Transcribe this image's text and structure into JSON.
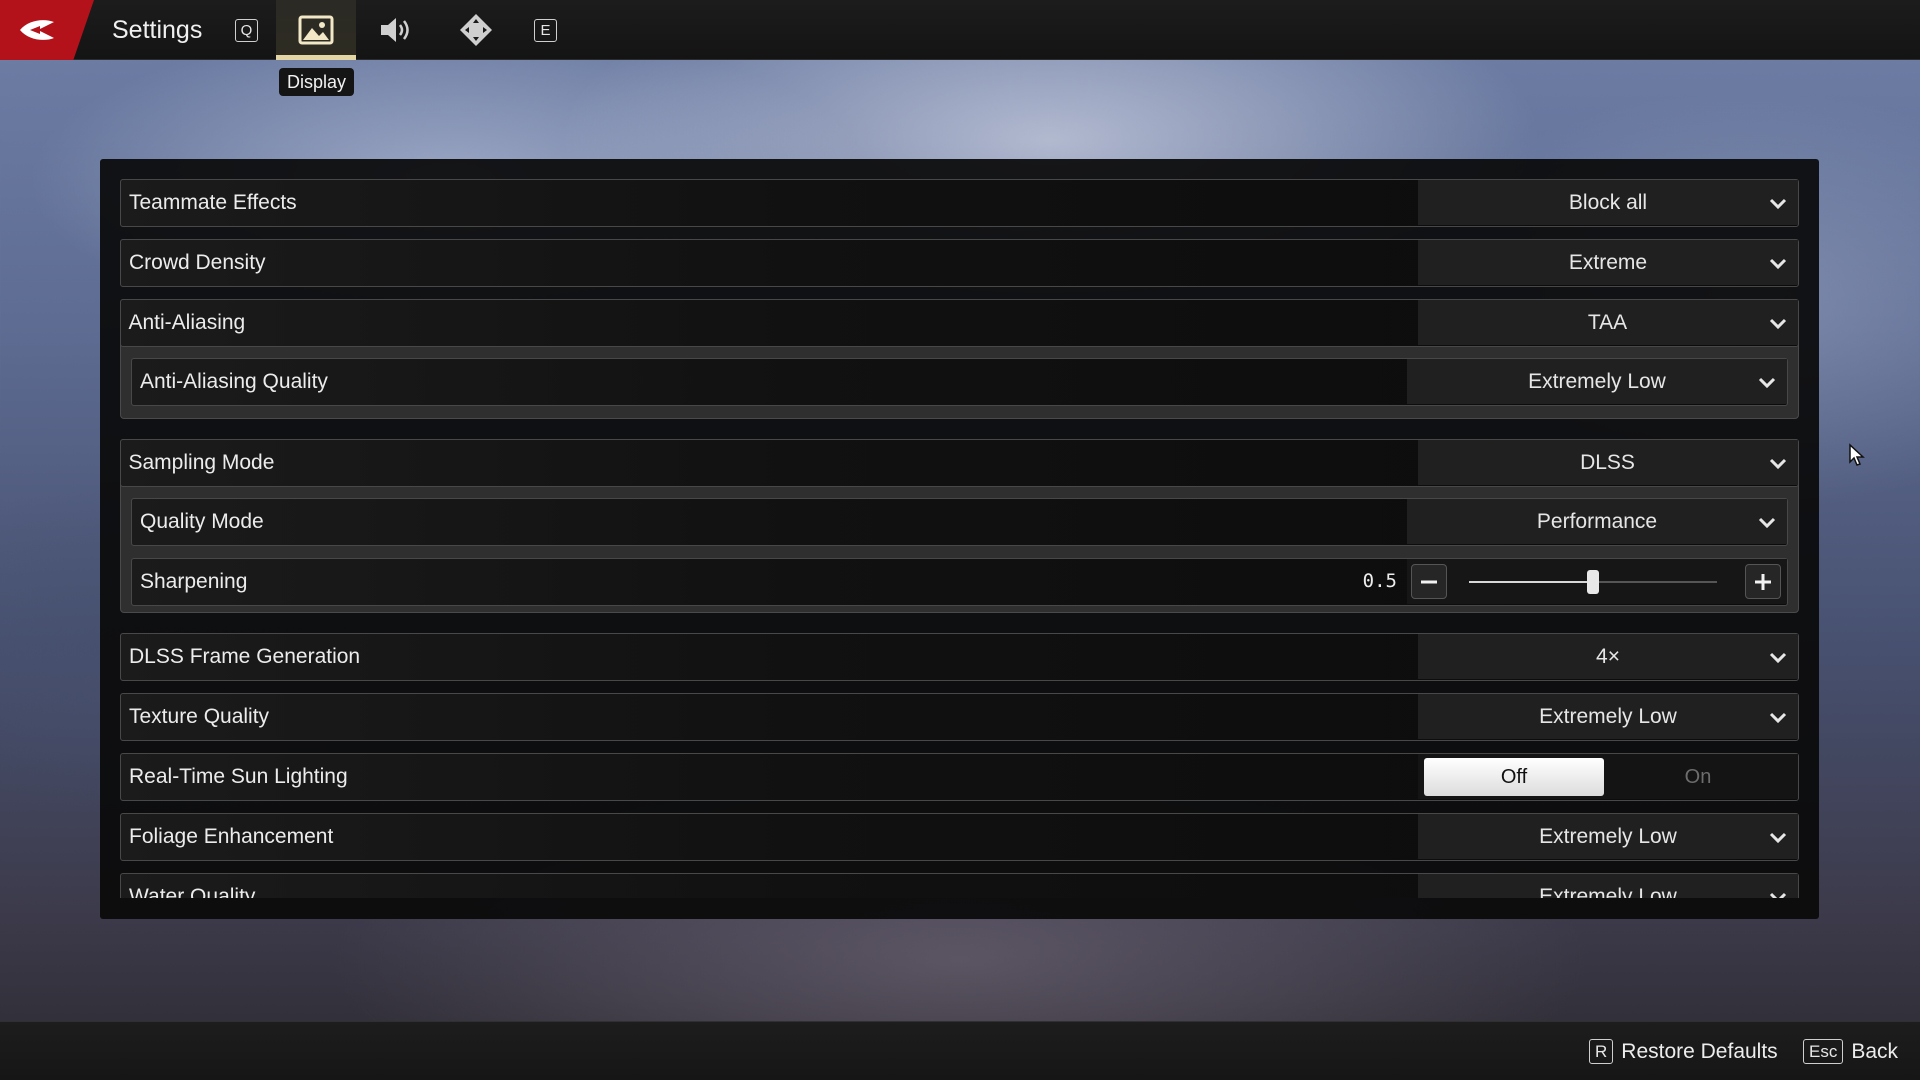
{
  "header": {
    "title": "Settings",
    "prev_key": "Q",
    "next_key": "E",
    "tabs": [
      {
        "name": "Display",
        "icon": "image-icon",
        "active": true
      },
      {
        "name": "Audio",
        "icon": "speaker-icon",
        "active": false
      },
      {
        "name": "Controls",
        "icon": "dpad-icon",
        "active": false
      }
    ],
    "tooltip": "Display"
  },
  "settings": {
    "teammate_effects": {
      "label": "Teammate Effects",
      "value": "Block all"
    },
    "crowd_density": {
      "label": "Crowd Density",
      "value": "Extreme"
    },
    "anti_aliasing": {
      "label": "Anti-Aliasing",
      "value": "TAA"
    },
    "anti_aliasing_quality": {
      "label": "Anti-Aliasing Quality",
      "value": "Extremely Low"
    },
    "sampling_mode": {
      "label": "Sampling Mode",
      "value": "DLSS"
    },
    "quality_mode": {
      "label": "Quality Mode",
      "value": "Performance"
    },
    "sharpening": {
      "label": "Sharpening",
      "value": "0.5",
      "min": 0,
      "max": 1,
      "level": 0.5
    },
    "dlss_frame_generation": {
      "label": "DLSS Frame Generation",
      "value": "4×"
    },
    "texture_quality": {
      "label": "Texture Quality",
      "value": "Extremely Low"
    },
    "real_time_sun_lighting": {
      "label": "Real-Time Sun Lighting",
      "off_label": "Off",
      "on_label": "On",
      "selected": "Off"
    },
    "foliage_enhancement": {
      "label": "Foliage Enhancement",
      "value": "Extremely Low"
    },
    "water_quality": {
      "label": "Water Quality",
      "value": "Extremely Low"
    }
  },
  "footer": {
    "restore_key": "R",
    "restore_label": "Restore Defaults",
    "back_key": "Esc",
    "back_label": "Back"
  },
  "colors": {
    "brand_red": "#b3121b",
    "active_tab_underline": "#e4d6a4"
  }
}
